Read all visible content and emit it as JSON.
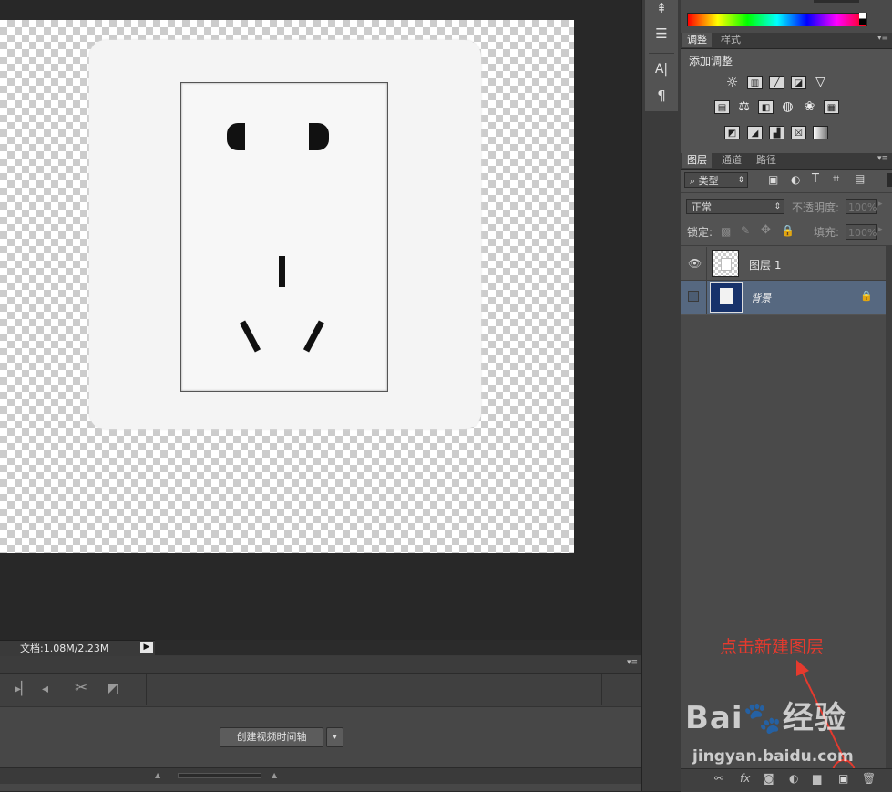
{
  "document": {
    "status_text": "文档:1.08M/2.23M",
    "status_arrow": "▶"
  },
  "timeline": {
    "menu_icon": "▾≡",
    "create_button_label": "创建视频时间轴",
    "create_dropdown_icon": "▾",
    "tool_icons": [
      "step-forward-icon",
      "audio-icon",
      "scissors-icon",
      "transition-icon"
    ]
  },
  "tools": {
    "icons": [
      "brush-tool-icon",
      "adjust-tool-icon",
      "character-tool-icon",
      "paragraph-tool-icon"
    ],
    "character_glyph": "A|",
    "paragraph_glyph": "¶"
  },
  "adjustments_panel": {
    "tabs": [
      "调整",
      "样式"
    ],
    "active_tab": "调整",
    "title": "添加调整",
    "icon_rows": [
      [
        "brightness-icon",
        "levels-icon",
        "curves-icon",
        "exposure-icon",
        "vibrance-icon"
      ],
      [
        "hue-saturation-icon",
        "color-balance-icon",
        "black-white-icon",
        "photo-filter-icon",
        "channel-mixer-icon",
        "color-lookup-icon"
      ],
      [
        "invert-icon",
        "posterize-icon",
        "threshold-icon",
        "selective-color-icon",
        "gradient-map-icon"
      ]
    ]
  },
  "layers_panel": {
    "tabs": [
      "图层",
      "通道",
      "路径"
    ],
    "active_tab": "图层",
    "filter_label": "类型",
    "filter_icons": [
      "pixel-filter-icon",
      "adjustment-filter-icon",
      "type-filter-icon",
      "shape-filter-icon",
      "smart-filter-icon"
    ],
    "blend_mode": "正常",
    "opacity_label": "不透明度:",
    "opacity_value": "100%",
    "lock_label": "锁定:",
    "fill_label": "填充:",
    "fill_value": "100%",
    "layers": [
      {
        "name": "图层 1",
        "visible": true,
        "selected": false,
        "locked": false
      },
      {
        "name": "背景",
        "visible": false,
        "selected": true,
        "locked": true
      }
    ],
    "footer_icons": [
      "link-icon",
      "fx-icon",
      "mask-icon",
      "adjustment-layer-icon",
      "group-folder-icon",
      "new-layer-icon",
      "trash-icon"
    ]
  },
  "annotation": {
    "text": "点击新建图层",
    "color": "#e53a2e"
  },
  "watermark": {
    "logo_text": "Bai🐾经验",
    "url": "jingyan.baidu.com"
  }
}
